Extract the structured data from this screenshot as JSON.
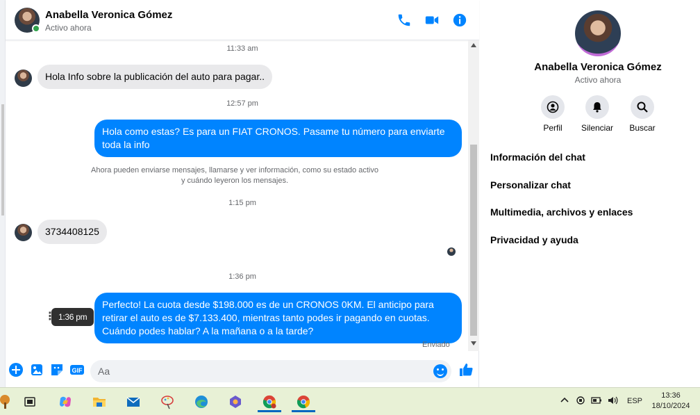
{
  "header": {
    "name": "Anabella Veronica Gómez",
    "status": "Activo ahora"
  },
  "messages": {
    "time1": "11:33 am",
    "msg1": "Hola Info sobre la publicación del auto para pagar..",
    "time2": "12:57 pm",
    "msg2": "Hola como estas?  Es para un FIAT CRONOS. Pasame tu número para enviarte toda la info",
    "note_line1": "Ahora pueden enviarse mensajes, llamarse y ver información, como su estado activo",
    "note_line2": "y cuándo leyeron los mensajes.",
    "time3": "1:15 pm",
    "msg3": "3734408125",
    "time4": "1:36 pm",
    "msg4": "Perfecto! La cuota desde $198.000 es de un CRONOS 0KM. El anticipo para retirar el auto es de $7.133.400, mientras tanto podes ir pagando en cuotas. Cuándo podes hablar? A la mañana o a la tarde?",
    "tooltip": "1:36 pm",
    "sent_status": "Enviado"
  },
  "composer": {
    "placeholder": "Aa"
  },
  "details": {
    "name": "Anabella Veronica Gómez",
    "status": "Activo ahora",
    "actions": [
      {
        "label": "Perfil",
        "icon": "profile-icon"
      },
      {
        "label": "Silenciar",
        "icon": "bell-icon"
      },
      {
        "label": "Buscar",
        "icon": "search-icon"
      }
    ],
    "sections": [
      "Información del chat",
      "Personalizar chat",
      "Multimedia, archivos y enlaces",
      "Privacidad y ayuda"
    ]
  },
  "taskbar": {
    "apps": [
      "task-view",
      "copilot",
      "file-explorer",
      "mail",
      "paint",
      "edge",
      "teams",
      "chrome-alt",
      "chrome"
    ],
    "lang": "ESP",
    "time": "13:36",
    "date": "18/10/2024"
  },
  "colors": {
    "accent": "#0084ff",
    "online": "#31a24c",
    "incoming_bubble": "#e9e9eb",
    "taskbar": "#e8f1d6"
  }
}
